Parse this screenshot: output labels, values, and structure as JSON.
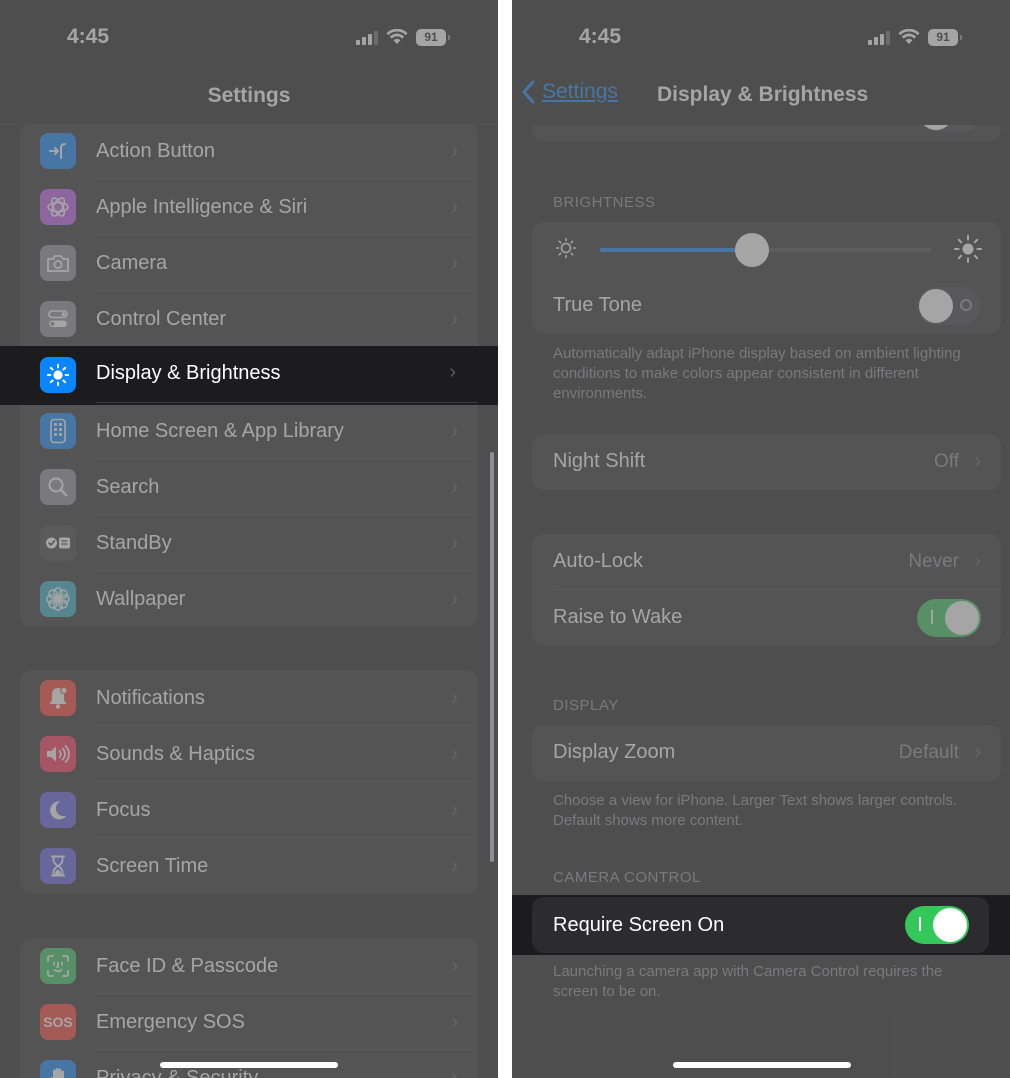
{
  "status_bar": {
    "time": "4:45",
    "battery": "91"
  },
  "left": {
    "nav_title": "Settings",
    "group1": [
      {
        "label": "Action Button",
        "icon": "action-button-icon",
        "color": "#0a84ff"
      },
      {
        "label": "Apple Intelligence & Siri",
        "icon": "siri-icon",
        "color": "#bf5af2"
      },
      {
        "label": "Camera",
        "icon": "camera-icon",
        "color": "#8e8e93"
      },
      {
        "label": "Control Center",
        "icon": "control-center-icon",
        "color": "#8e8e93"
      },
      {
        "label": "Display & Brightness",
        "icon": "brightness-icon",
        "color": "#0a84ff"
      },
      {
        "label": "Home Screen & App Library",
        "icon": "home-screen-icon",
        "color": "#0a84ff"
      },
      {
        "label": "Search",
        "icon": "search-icon",
        "color": "#8e8e93"
      },
      {
        "label": "StandBy",
        "icon": "standby-icon",
        "color": "#3a3a3c"
      },
      {
        "label": "Wallpaper",
        "icon": "wallpaper-flower-icon",
        "color": "#30b0c7"
      }
    ],
    "group2": [
      {
        "label": "Notifications",
        "icon": "bell-icon",
        "color": "#ff3b30"
      },
      {
        "label": "Sounds & Haptics",
        "icon": "speaker-icon",
        "color": "#ff2d55"
      },
      {
        "label": "Focus",
        "icon": "moon-icon",
        "color": "#5e5ce6"
      },
      {
        "label": "Screen Time",
        "icon": "hourglass-icon",
        "color": "#5e5ce6"
      }
    ],
    "group3": [
      {
        "label": "Face ID & Passcode",
        "icon": "face-id-icon",
        "color": "#34c759"
      },
      {
        "label": "Emergency SOS",
        "icon": "sos-icon",
        "color": "#ff3b30"
      },
      {
        "label": "Privacy & Security",
        "icon": "hand-icon",
        "color": "#0a84ff"
      }
    ],
    "highlighted_label": "Display & Brightness",
    "sos_text": "SOS"
  },
  "right": {
    "back_label": "Settings",
    "nav_title": "Display & Brightness",
    "brightness_header": "BRIGHTNESS",
    "brightness_level": 0.46,
    "true_tone_label": "True Tone",
    "true_tone_on": false,
    "true_tone_footnote": "Automatically adapt iPhone display based on ambient lighting conditions to make colors appear consistent in different environments.",
    "night_shift_label": "Night Shift",
    "night_shift_value": "Off",
    "auto_lock_label": "Auto-Lock",
    "auto_lock_value": "Never",
    "raise_to_wake_label": "Raise to Wake",
    "raise_to_wake_on": true,
    "display_header": "DISPLAY",
    "display_zoom_label": "Display Zoom",
    "display_zoom_value": "Default",
    "display_zoom_footnote": "Choose a view for iPhone. Larger Text shows larger controls. Default shows more content.",
    "camera_control_header": "CAMERA CONTROL",
    "require_screen_on_label": "Require Screen On",
    "require_screen_on": true,
    "camera_control_footnote": "Launching a camera app with Camera Control requires the screen to be on."
  }
}
